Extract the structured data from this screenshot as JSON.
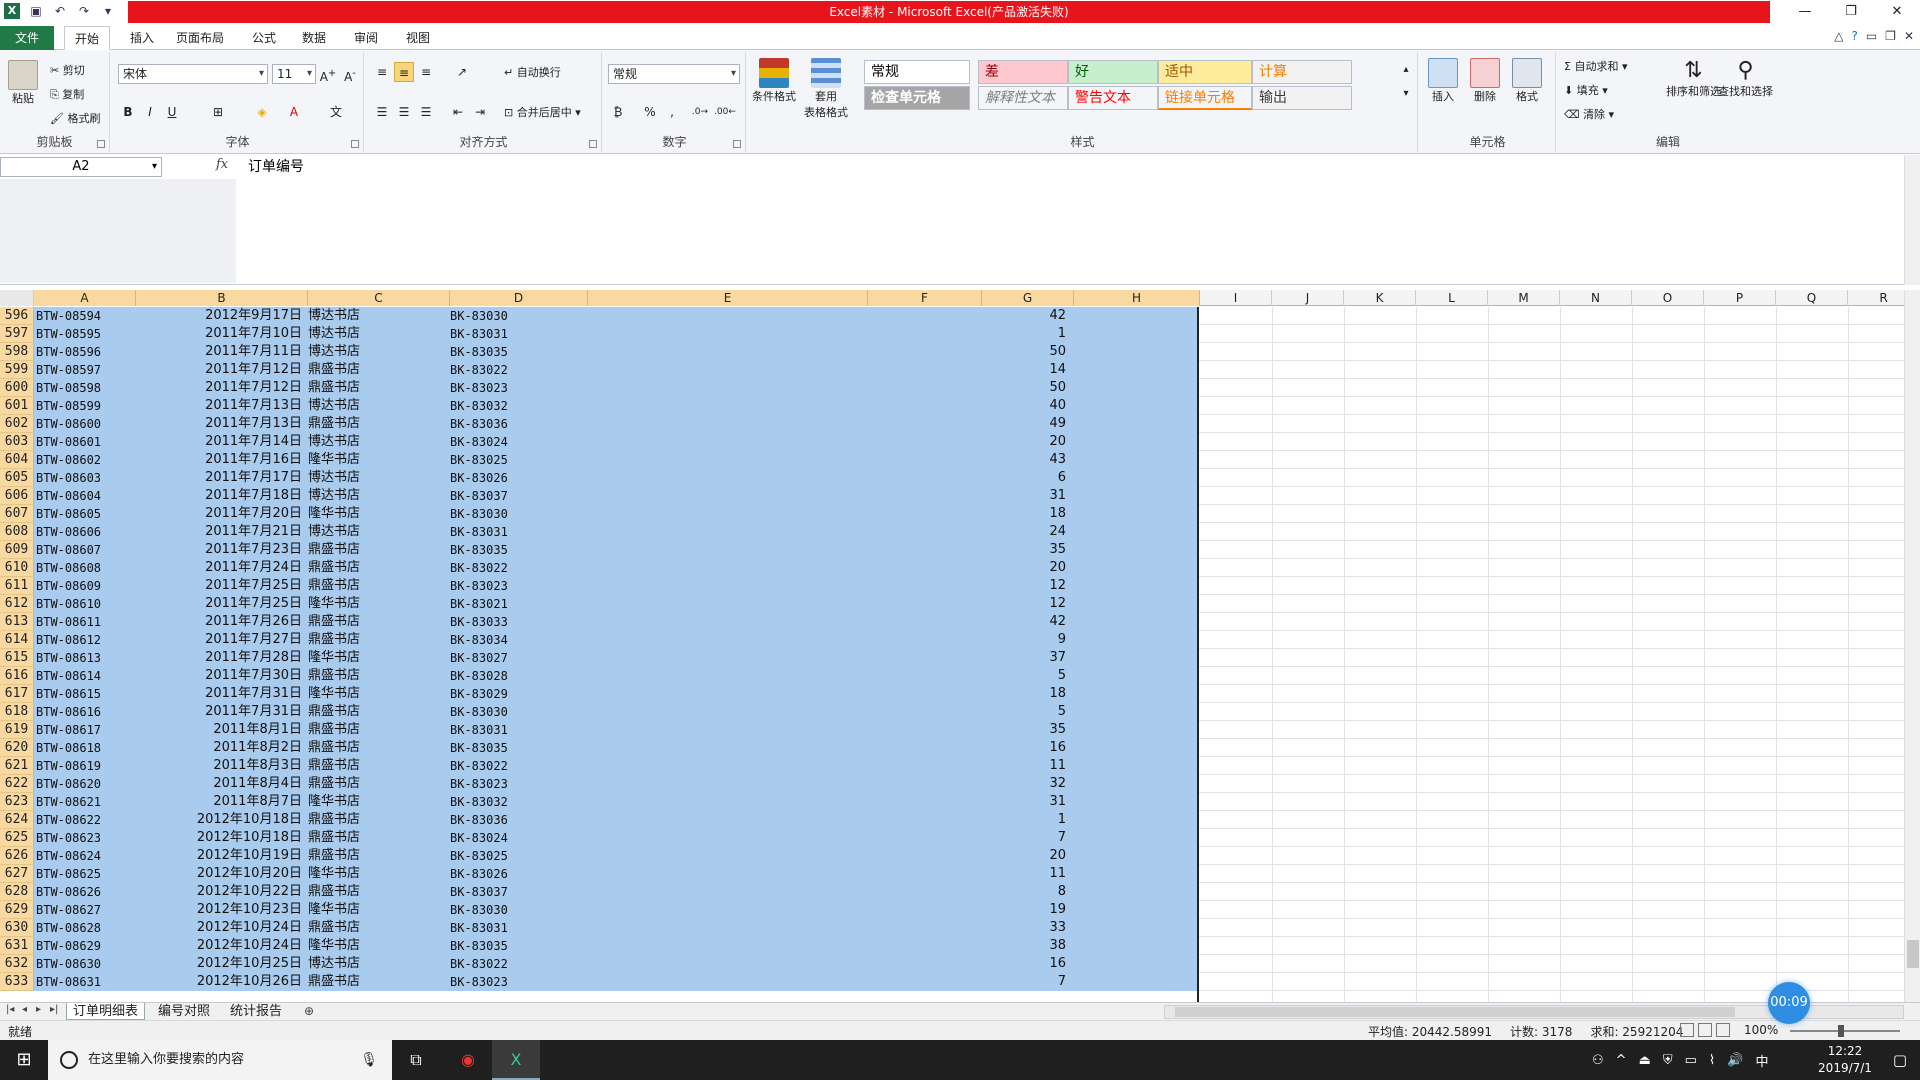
{
  "titlebar": {
    "title": "Excel素材 - Microsoft Excel(产品激活失败)",
    "controls": [
      "—",
      "❐",
      "✕"
    ]
  },
  "tabs": {
    "file": "文件",
    "items": [
      "开始",
      "插入",
      "页面布局",
      "公式",
      "数据",
      "审阅",
      "视图"
    ],
    "active": "开始"
  },
  "ribbon": {
    "clipboard": {
      "label": "剪贴板",
      "paste": "粘贴",
      "cut": "剪切",
      "copy": "复制",
      "format_painter": "格式刷"
    },
    "font": {
      "label": "字体",
      "name": "宋体",
      "size": "11",
      "bold": "B",
      "italic": "I",
      "underline": "U"
    },
    "alignment": {
      "label": "对齐方式",
      "wrap": "自动换行",
      "merge": "合并后居中"
    },
    "number": {
      "label": "数字",
      "format": "常规",
      "percent": "%",
      "comma": ","
    },
    "styles": {
      "label": "样式",
      "conditional": "条件格式",
      "table_line1": "套用",
      "table_line2": "表格格式",
      "cells": [
        {
          "text": "常规",
          "bg": "#ffffff",
          "fg": "#000000"
        },
        {
          "text": "差",
          "bg": "#ffc7ce",
          "fg": "#9c0006"
        },
        {
          "text": "好",
          "bg": "#c6efce",
          "fg": "#006100"
        },
        {
          "text": "适中",
          "bg": "#ffeb9c",
          "fg": "#9c5700"
        },
        {
          "text": "计算",
          "bg": "#f2f2f2",
          "fg": "#fa7d00"
        },
        {
          "text": "检查单元格",
          "bg": "#a5a5a5",
          "fg": "#ffffff"
        },
        {
          "text": "解释性文本",
          "bg": "#f3f5f8",
          "fg": "#7f7f7f"
        },
        {
          "text": "警告文本",
          "bg": "#f3f5f8",
          "fg": "#ff0000"
        },
        {
          "text": "链接单元格",
          "bg": "#f3f5f8",
          "fg": "#fa7d00"
        },
        {
          "text": "输出",
          "bg": "#f2f2f2",
          "fg": "#3f3f3f"
        }
      ]
    },
    "cells_group": {
      "label": "单元格",
      "insert": "插入",
      "delete": "删除",
      "format": "格式"
    },
    "editing": {
      "label": "编辑",
      "autosum": "自动求和",
      "fill": "填充",
      "clear": "清除",
      "sort": "排序和筛选",
      "find": "查找和选择"
    }
  },
  "formula": {
    "namebox": "A2",
    "fx": "fx",
    "value": "订单编号"
  },
  "grid": {
    "columns": [
      "A",
      "B",
      "C",
      "D",
      "E",
      "F",
      "G",
      "H",
      "I",
      "J",
      "K",
      "L",
      "M",
      "N",
      "O",
      "P",
      "Q",
      "R"
    ],
    "rows": [
      [
        "596",
        "BTW-08594",
        "2012年9月17日",
        "博达书店",
        "BK-83030",
        "42"
      ],
      [
        "597",
        "BTW-08595",
        "2011年7月10日",
        "博达书店",
        "BK-83031",
        "1"
      ],
      [
        "598",
        "BTW-08596",
        "2011年7月11日",
        "博达书店",
        "BK-83035",
        "50"
      ],
      [
        "599",
        "BTW-08597",
        "2011年7月12日",
        "鼎盛书店",
        "BK-83022",
        "14"
      ],
      [
        "600",
        "BTW-08598",
        "2011年7月12日",
        "鼎盛书店",
        "BK-83023",
        "50"
      ],
      [
        "601",
        "BTW-08599",
        "2011年7月13日",
        "博达书店",
        "BK-83032",
        "40"
      ],
      [
        "602",
        "BTW-08600",
        "2011年7月13日",
        "鼎盛书店",
        "BK-83036",
        "49"
      ],
      [
        "603",
        "BTW-08601",
        "2011年7月14日",
        "博达书店",
        "BK-83024",
        "20"
      ],
      [
        "604",
        "BTW-08602",
        "2011年7月16日",
        "隆华书店",
        "BK-83025",
        "43"
      ],
      [
        "605",
        "BTW-08603",
        "2011年7月17日",
        "博达书店",
        "BK-83026",
        "6"
      ],
      [
        "606",
        "BTW-08604",
        "2011年7月18日",
        "博达书店",
        "BK-83037",
        "31"
      ],
      [
        "607",
        "BTW-08605",
        "2011年7月20日",
        "隆华书店",
        "BK-83030",
        "18"
      ],
      [
        "608",
        "BTW-08606",
        "2011年7月21日",
        "博达书店",
        "BK-83031",
        "24"
      ],
      [
        "609",
        "BTW-08607",
        "2011年7月23日",
        "鼎盛书店",
        "BK-83035",
        "35"
      ],
      [
        "610",
        "BTW-08608",
        "2011年7月24日",
        "鼎盛书店",
        "BK-83022",
        "20"
      ],
      [
        "611",
        "BTW-08609",
        "2011年7月25日",
        "鼎盛书店",
        "BK-83023",
        "12"
      ],
      [
        "612",
        "BTW-08610",
        "2011年7月25日",
        "隆华书店",
        "BK-83021",
        "12"
      ],
      [
        "613",
        "BTW-08611",
        "2011年7月26日",
        "鼎盛书店",
        "BK-83033",
        "42"
      ],
      [
        "614",
        "BTW-08612",
        "2011年7月27日",
        "鼎盛书店",
        "BK-83034",
        "9"
      ],
      [
        "615",
        "BTW-08613",
        "2011年7月28日",
        "隆华书店",
        "BK-83027",
        "37"
      ],
      [
        "616",
        "BTW-08614",
        "2011年7月30日",
        "鼎盛书店",
        "BK-83028",
        "5"
      ],
      [
        "617",
        "BTW-08615",
        "2011年7月31日",
        "隆华书店",
        "BK-83029",
        "18"
      ],
      [
        "618",
        "BTW-08616",
        "2011年7月31日",
        "鼎盛书店",
        "BK-83030",
        "5"
      ],
      [
        "619",
        "BTW-08617",
        "2011年8月1日",
        "鼎盛书店",
        "BK-83031",
        "35"
      ],
      [
        "620",
        "BTW-08618",
        "2011年8月2日",
        "鼎盛书店",
        "BK-83035",
        "16"
      ],
      [
        "621",
        "BTW-08619",
        "2011年8月3日",
        "鼎盛书店",
        "BK-83022",
        "11"
      ],
      [
        "622",
        "BTW-08620",
        "2011年8月4日",
        "鼎盛书店",
        "BK-83023",
        "32"
      ],
      [
        "623",
        "BTW-08621",
        "2011年8月7日",
        "隆华书店",
        "BK-83032",
        "31"
      ],
      [
        "624",
        "BTW-08622",
        "2012年10月18日",
        "鼎盛书店",
        "BK-83036",
        "1"
      ],
      [
        "625",
        "BTW-08623",
        "2012年10月18日",
        "鼎盛书店",
        "BK-83024",
        "7"
      ],
      [
        "626",
        "BTW-08624",
        "2012年10月19日",
        "鼎盛书店",
        "BK-83025",
        "20"
      ],
      [
        "627",
        "BTW-08625",
        "2012年10月20日",
        "隆华书店",
        "BK-83026",
        "11"
      ],
      [
        "628",
        "BTW-08626",
        "2012年10月22日",
        "鼎盛书店",
        "BK-83037",
        "8"
      ],
      [
        "629",
        "BTW-08627",
        "2012年10月23日",
        "隆华书店",
        "BK-83030",
        "19"
      ],
      [
        "630",
        "BTW-08628",
        "2012年10月24日",
        "鼎盛书店",
        "BK-83031",
        "33"
      ],
      [
        "631",
        "BTW-08629",
        "2012年10月24日",
        "隆华书店",
        "BK-83035",
        "38"
      ],
      [
        "632",
        "BTW-08630",
        "2012年10月25日",
        "博达书店",
        "BK-83022",
        "16"
      ],
      [
        "633",
        "BTW-08631",
        "2012年10月26日",
        "鼎盛书店",
        "BK-83023",
        "7"
      ]
    ]
  },
  "sheets": {
    "tabs": [
      "订单明细表",
      "编号对照",
      "统计报告"
    ],
    "active": "订单明细表"
  },
  "status": {
    "ready": "就绪",
    "average": "平均值: 20442.58991",
    "count": "计数: 3178",
    "sum": "求和: 25921204",
    "zoom": "100%"
  },
  "timer": "00:09",
  "taskbar": {
    "search_placeholder": "在这里输入你要搜索的内容",
    "time": "12:22",
    "date": "2019/7/1",
    "ime": "中"
  },
  "colors": {
    "selection": "#a9cbed",
    "header_selected": "#f9d99f",
    "title_red": "#e8141c",
    "excel_green": "#1f7a45"
  }
}
